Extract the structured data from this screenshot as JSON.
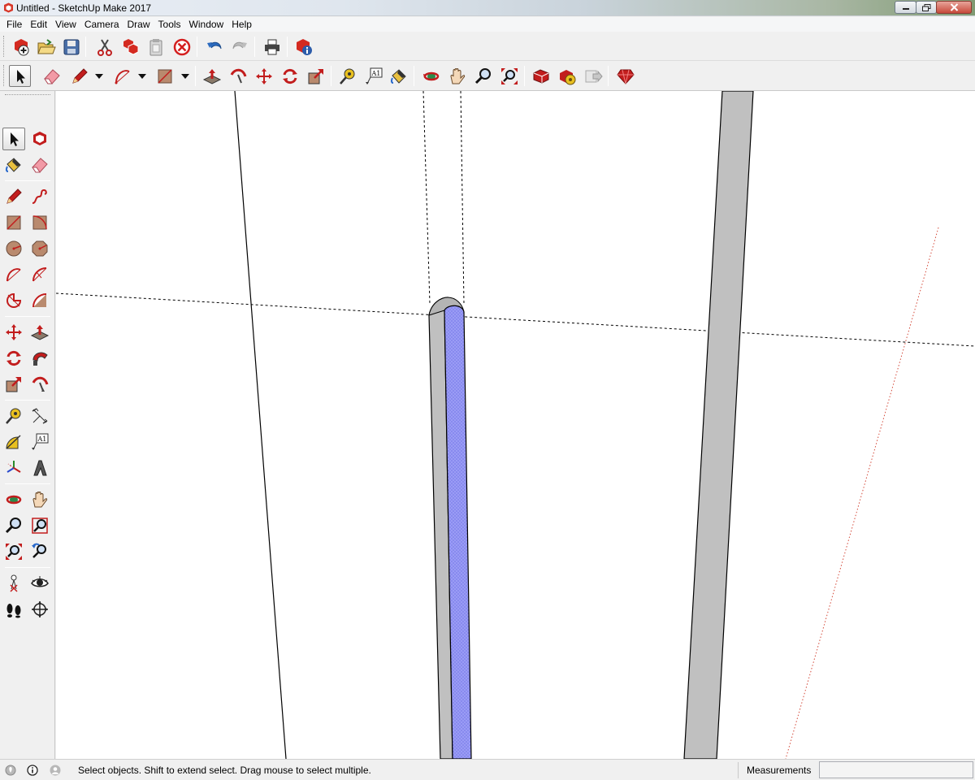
{
  "window": {
    "title": "Untitled - SketchUp Make 2017",
    "minimize_icon": "minimize-icon",
    "maximize_icon": "maximize-icon",
    "close_icon": "close-icon"
  },
  "menu": {
    "items": [
      "File",
      "Edit",
      "View",
      "Camera",
      "Draw",
      "Tools",
      "Window",
      "Help"
    ]
  },
  "toolbar_standard": {
    "icons": [
      "new-file-icon",
      "open-folder-icon",
      "save-icon",
      "cut-icon",
      "copy-icon",
      "paste-icon",
      "erase-icon",
      "undo-icon",
      "redo-icon",
      "print-icon",
      "model-info-icon"
    ]
  },
  "toolbar_getting_started": {
    "icons": [
      "select-arrow-icon",
      "eraser-icon",
      "pencil-icon",
      "arc-icon",
      "rectangle-icon",
      "push-pull-icon",
      "follow-me-icon",
      "move-icon",
      "rotate-icon",
      "scale-icon",
      "tape-measure-icon",
      "text-icon",
      "paint-bucket-icon",
      "orbit-icon",
      "pan-icon",
      "zoom-icon",
      "zoom-extents-icon",
      "3d-warehouse-icon",
      "extension-warehouse-icon",
      "send-to-layout-icon",
      "ruby-icon"
    ],
    "text_icon_label": "A1"
  },
  "toolbar_large": {
    "icons": [
      "select-icon",
      "make-component-icon",
      "paint-bucket-icon",
      "eraser-icon",
      "line-icon",
      "freehand-icon",
      "rectangle-icon",
      "rotated-rectangle-icon",
      "circle-icon",
      "polygon-icon",
      "arc-icon",
      "two-point-arc-icon",
      "pie-icon",
      "three-point-arc-icon",
      "move-icon",
      "push-pull-icon",
      "rotate-icon",
      "follow-me-icon",
      "scale-icon",
      "offset-icon",
      "tape-measure-icon",
      "dimension-icon",
      "protractor-icon",
      "text-icon",
      "axes-icon",
      "3d-text-icon",
      "orbit-icon",
      "pan-icon",
      "zoom-icon",
      "zoom-window-icon",
      "zoom-extents-icon",
      "previous-view-icon",
      "position-camera-icon",
      "look-around-icon",
      "walk-icon",
      "section-plane-icon"
    ],
    "text_icon_label": "A1"
  },
  "status": {
    "geo_icon": "geo-location-icon",
    "info_icon": "info-icon",
    "user_icon": "user-icon",
    "message": "Select objects. Shift to extend select. Drag mouse to select multiple.",
    "measurements_label": "Measurements",
    "measurements_value": ""
  },
  "colors": {
    "selected_face": "#9a9cf5",
    "column_face": "#c0c0c0",
    "edge": "#000000",
    "guide": "#000000",
    "axis_red": "#d44a3a"
  }
}
